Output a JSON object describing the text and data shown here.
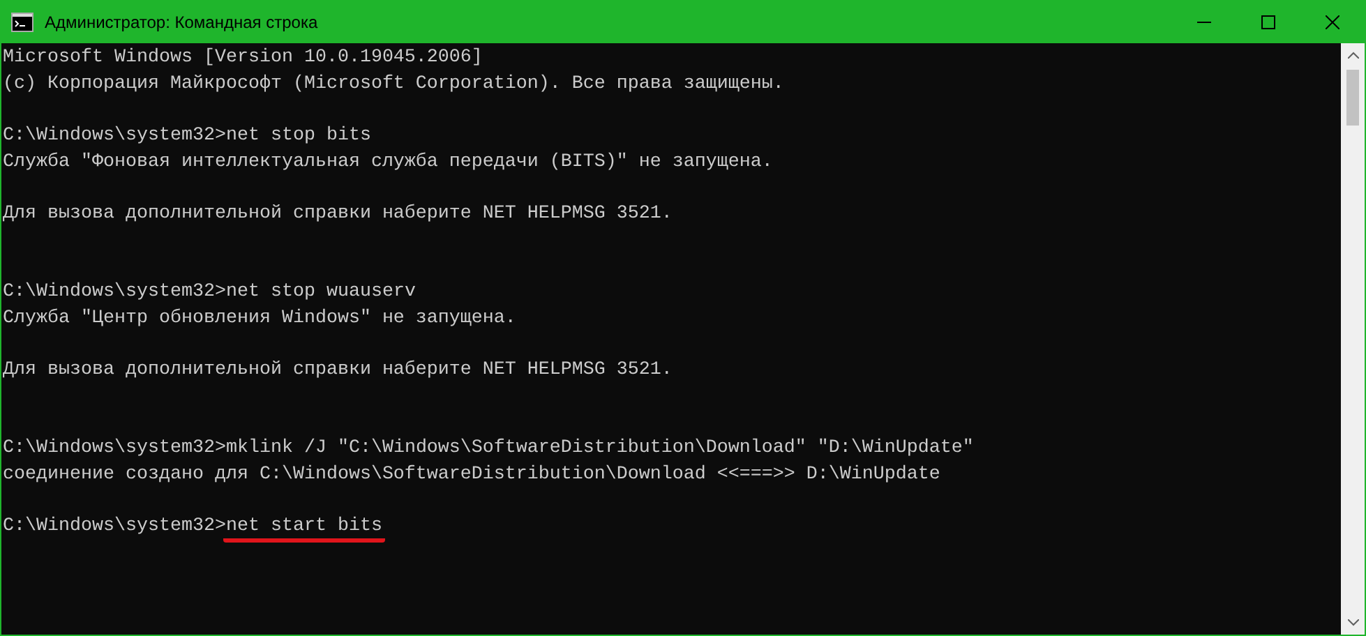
{
  "window": {
    "title": "Администратор: Командная строка"
  },
  "console": {
    "lines": [
      {
        "kind": "output",
        "text": "Microsoft Windows [Version 10.0.19045.2006]"
      },
      {
        "kind": "output",
        "text": "(c) Корпорация Майкрософт (Microsoft Corporation). Все права защищены."
      },
      {
        "kind": "blank"
      },
      {
        "kind": "command",
        "prompt": "C:\\Windows\\system32>",
        "command": "net stop bits",
        "underlined": false
      },
      {
        "kind": "output",
        "text": "Служба \"Фоновая интеллектуальная служба передачи (BITS)\" не запущена."
      },
      {
        "kind": "blank"
      },
      {
        "kind": "output",
        "text": "Для вызова дополнительной справки наберите NET HELPMSG 3521."
      },
      {
        "kind": "blank"
      },
      {
        "kind": "blank"
      },
      {
        "kind": "command",
        "prompt": "C:\\Windows\\system32>",
        "command": "net stop wuauserv",
        "underlined": false
      },
      {
        "kind": "output",
        "text": "Служба \"Центр обновления Windows\" не запущена."
      },
      {
        "kind": "blank"
      },
      {
        "kind": "output",
        "text": "Для вызова дополнительной справки наберите NET HELPMSG 3521."
      },
      {
        "kind": "blank"
      },
      {
        "kind": "blank"
      },
      {
        "kind": "command",
        "prompt": "C:\\Windows\\system32>",
        "command": "mklink /J \"C:\\Windows\\SoftwareDistribution\\Download\" \"D:\\WinUpdate\"",
        "underlined": false
      },
      {
        "kind": "output",
        "text": "соединение создано для C:\\Windows\\SoftwareDistribution\\Download <<===>> D:\\WinUpdate"
      },
      {
        "kind": "blank"
      },
      {
        "kind": "command",
        "prompt": "C:\\Windows\\system32>",
        "command": "net start bits",
        "underlined": true
      }
    ]
  }
}
